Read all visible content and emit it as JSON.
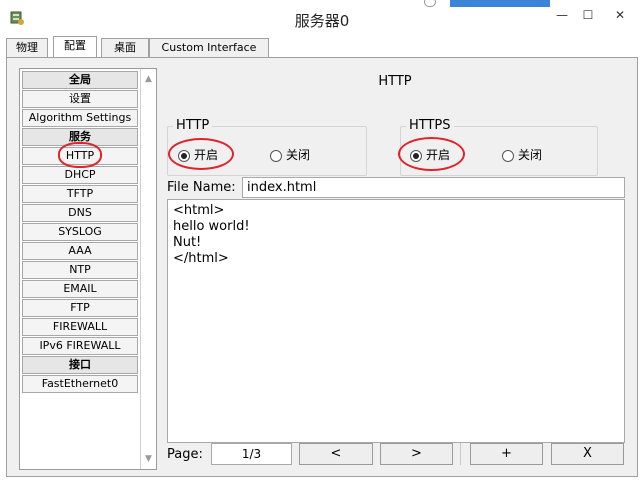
{
  "window": {
    "title": "服务器0",
    "controls": {
      "minimize": "—",
      "maximize": "☐",
      "close": "✕"
    }
  },
  "tabs": [
    {
      "label": "物理",
      "active": false
    },
    {
      "label": "配置",
      "active": true
    },
    {
      "label": "桌面",
      "active": false
    },
    {
      "label": "Custom Interface",
      "active": false
    }
  ],
  "sidebar": {
    "items": [
      {
        "label": "全局",
        "header": true
      },
      {
        "label": "设置",
        "header": false
      },
      {
        "label": "Algorithm Settings",
        "header": false
      },
      {
        "label": "服务",
        "header": true
      },
      {
        "label": "HTTP",
        "header": false
      },
      {
        "label": "DHCP",
        "header": false
      },
      {
        "label": "TFTP",
        "header": false
      },
      {
        "label": "DNS",
        "header": false
      },
      {
        "label": "SYSLOG",
        "header": false
      },
      {
        "label": "AAA",
        "header": false
      },
      {
        "label": "NTP",
        "header": false
      },
      {
        "label": "EMAIL",
        "header": false
      },
      {
        "label": "FTP",
        "header": false
      },
      {
        "label": "FIREWALL",
        "header": false
      },
      {
        "label": "IPv6 FIREWALL",
        "header": false
      },
      {
        "label": "接口",
        "header": true
      },
      {
        "label": "FastEthernet0",
        "header": false
      }
    ],
    "selected": "HTTP"
  },
  "main": {
    "header": "HTTP",
    "http": {
      "legend": "HTTP",
      "on_label": "开启",
      "off_label": "关闭",
      "selected": "on"
    },
    "https": {
      "legend": "HTTPS",
      "on_label": "开启",
      "off_label": "关闭",
      "selected": "on"
    },
    "file_name_label": "File Name:",
    "file_name_value": "index.html",
    "editor_lines": [
      "<html>",
      "hello world!",
      "Nut!",
      "</html>"
    ],
    "page_label": "Page:",
    "page_value": "1/3",
    "buttons": {
      "prev": "<",
      "next": ">",
      "add": "+",
      "delete": "X"
    }
  },
  "colors": {
    "annotation": "#e0232a",
    "panel_bg": "#f0f0f0"
  }
}
